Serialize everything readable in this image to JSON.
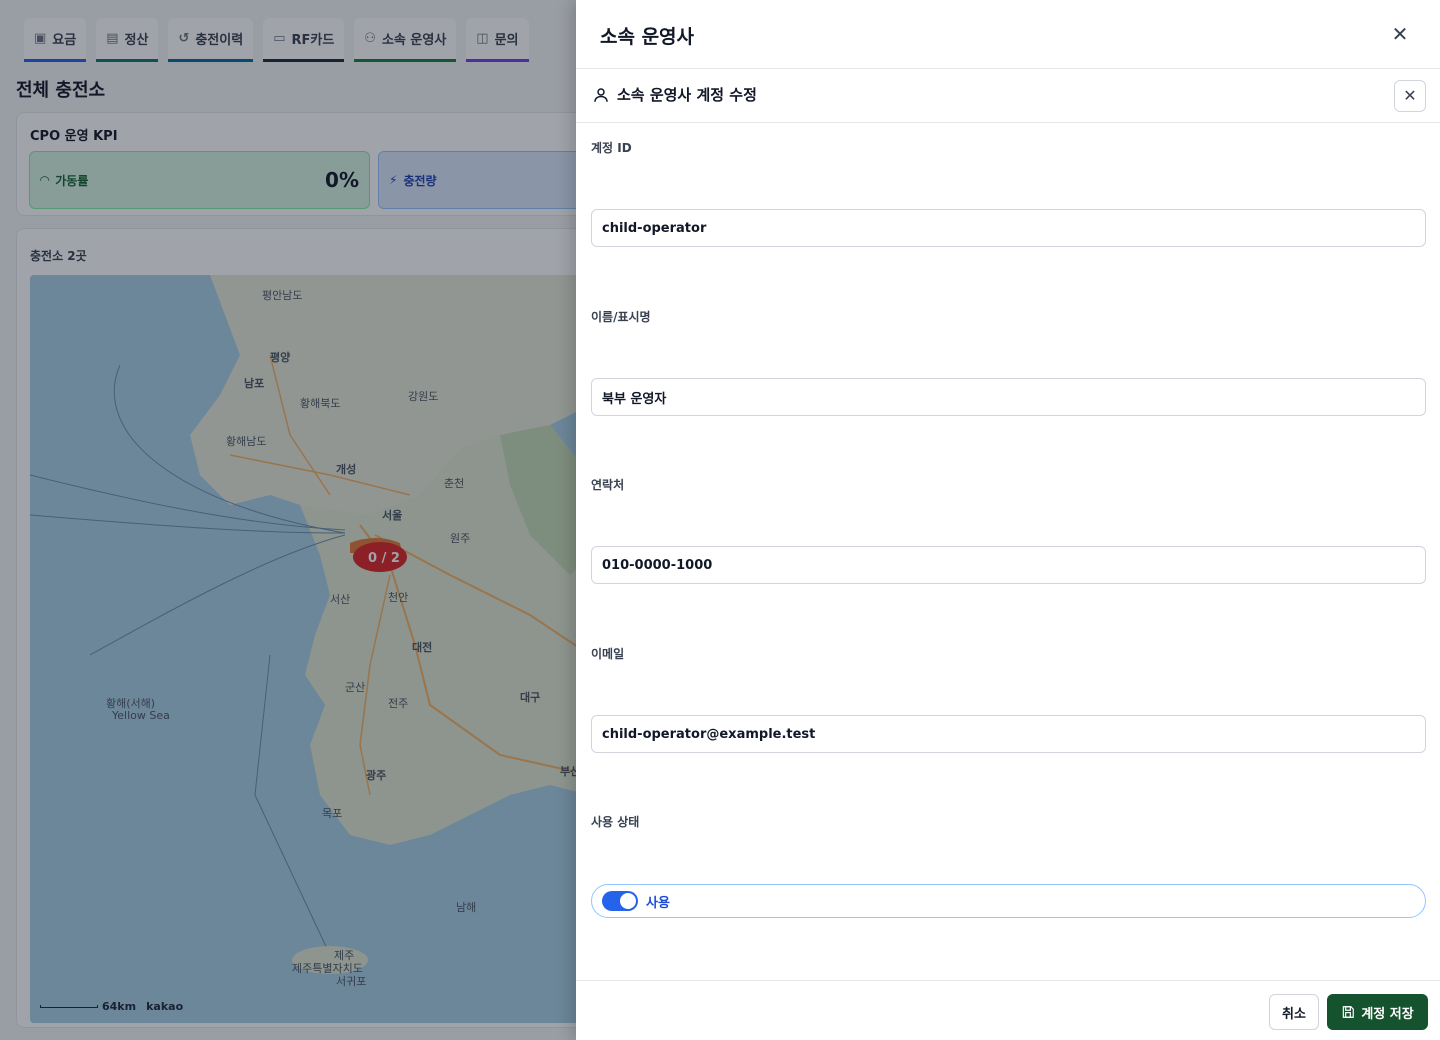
{
  "tabs": [
    {
      "label": "요금",
      "icon": "fee-icon"
    },
    {
      "label": "정산",
      "icon": "settlement-icon"
    },
    {
      "label": "충전이력",
      "icon": "history-icon"
    },
    {
      "label": "RF카드",
      "icon": "card-icon"
    },
    {
      "label": "소속 운영사",
      "icon": "org-icon"
    },
    {
      "label": "문의",
      "icon": "inquiry-icon"
    }
  ],
  "page": {
    "title": "전체 충전소",
    "kpi_title": "CPO 운영 KPI",
    "kpi_uptime_label": "가동률",
    "kpi_uptime_value": "0%",
    "kpi_charge_label": "충전량",
    "map_label": "충전소 2곳",
    "map_cluster": "0 / 2",
    "map_scale": "64km",
    "map_brand": "kakao",
    "map_places": [
      "평안남도",
      "평양",
      "남포",
      "황해북도",
      "황해남도",
      "강원도",
      "개성",
      "서울",
      "춘천",
      "원주",
      "서산",
      "천안",
      "대전",
      "대구",
      "군산",
      "전주",
      "광주",
      "목포",
      "부산",
      "남해",
      "황해(서해)",
      "Yellow Sea",
      "제주",
      "서귀포",
      "제주특별자치도"
    ]
  },
  "drawer": {
    "title": "소속 운영사",
    "sub_title": "소속 운영사 계정 수정",
    "fields": {
      "account_id_label": "계정 ID",
      "account_id_value": "child-operator",
      "name_label": "이름/표시명",
      "name_value": "북부 운영자",
      "contact_label": "연락처",
      "contact_value": "010-0000-1000",
      "email_label": "이메일",
      "email_value": "child-operator@example.test",
      "status_label": "사용 상태",
      "status_value": "사용"
    },
    "cancel_label": "취소",
    "save_label": "계정 저장"
  },
  "colors": {
    "save_button": "#14532d",
    "toggle_on": "#2563eb",
    "overlay": "rgba(17,24,39,0.40)"
  }
}
